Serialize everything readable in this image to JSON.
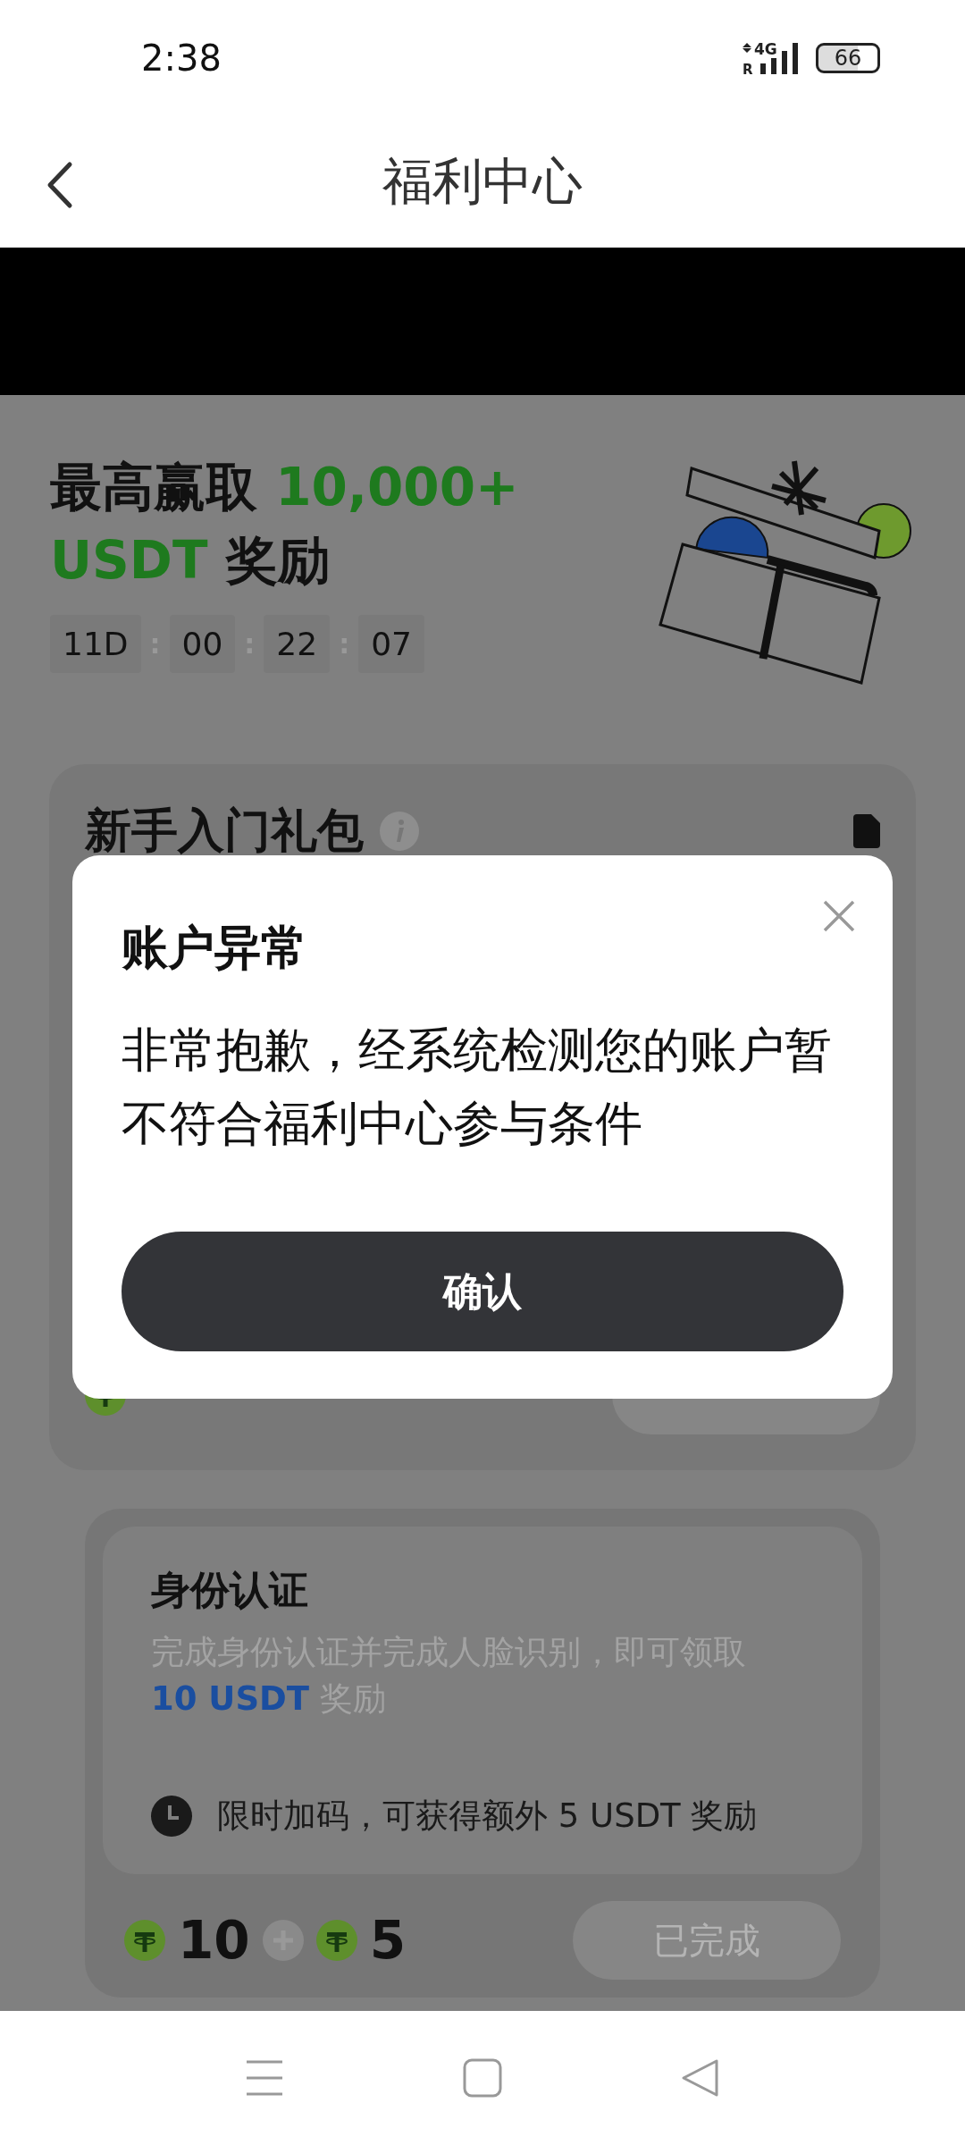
{
  "status_bar": {
    "time": "2:38",
    "network": "4G",
    "roaming": "R",
    "battery": "66"
  },
  "header": {
    "title": "福利中心"
  },
  "hero": {
    "headline": [
      {
        "text": "最高赢取 ",
        "highlight": false
      },
      {
        "text": "10,000+ USDT",
        "highlight": true
      },
      {
        "text": " 奖励",
        "highlight": false
      }
    ],
    "countdown": {
      "units": [
        "11D",
        "00",
        "22",
        "07"
      ],
      "separator": ":"
    }
  },
  "cards": [
    {
      "title": "新手入门礼包"
    },
    {
      "title": "身份认证",
      "description": [
        {
          "text": "完成身份认证并完成人脸识别，即可领取 ",
          "highlight": false
        },
        {
          "text": "10 USDT",
          "highlight": true
        },
        {
          "text": " 奖励",
          "highlight": false
        }
      ],
      "bonus": "限时加码，可获得额外 5 USDT 奖励",
      "rewards": [
        "10",
        "5"
      ],
      "button": "已完成"
    }
  ],
  "dialog": {
    "title": "账户异常",
    "message": "非常抱歉，经系统检测您的账户暂不符合福利中心参与条件",
    "confirm": "确认"
  }
}
